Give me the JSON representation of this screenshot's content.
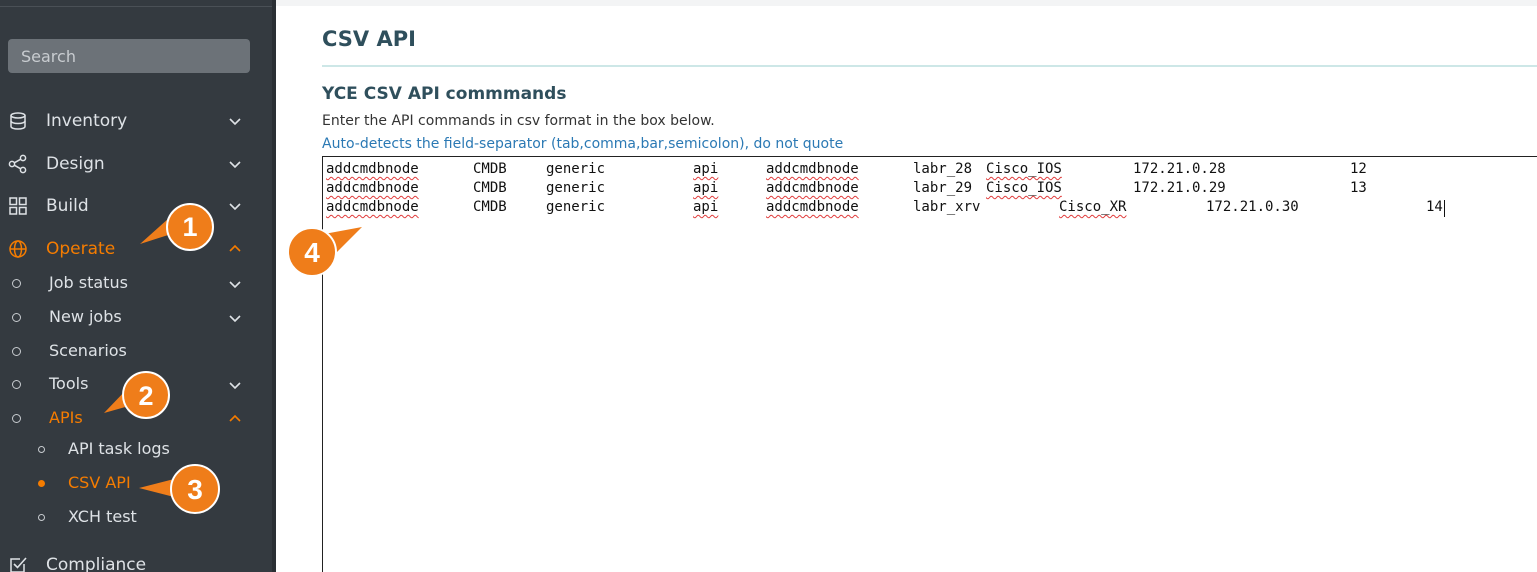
{
  "sidebar": {
    "search_placeholder": "Search",
    "items": [
      {
        "label": "Inventory",
        "icon": "database-icon",
        "expanded": false
      },
      {
        "label": "Design",
        "icon": "share-nodes-icon",
        "expanded": false
      },
      {
        "label": "Build",
        "icon": "grid-icon",
        "expanded": false
      },
      {
        "label": "Operate",
        "icon": "globe-icon",
        "expanded": true,
        "active": true
      },
      {
        "label": "Compliance",
        "icon": "checkbox-icon",
        "expanded": false
      }
    ],
    "operate_children": [
      {
        "label": "Job status",
        "has_children": true
      },
      {
        "label": "New jobs",
        "has_children": true
      },
      {
        "label": "Scenarios",
        "has_children": false
      },
      {
        "label": "Tools",
        "has_children": true
      },
      {
        "label": "APIs",
        "has_children": true,
        "expanded": true,
        "active": true
      }
    ],
    "apis_children": [
      {
        "label": "API task logs",
        "active": false
      },
      {
        "label": "CSV API",
        "active": true
      },
      {
        "label": "XCH test",
        "active": false
      }
    ]
  },
  "callouts": [
    "1",
    "2",
    "3",
    "4"
  ],
  "main": {
    "title": "CSV API",
    "section_title": "YCE CSV API commmands",
    "instruction": "Enter the API commands in csv format in the box below.",
    "hint": "Auto-detects the field-separator (tab,comma,bar,semicolon), do not quote",
    "csv_rows": [
      [
        "addcmdbnode",
        "CMDB",
        "generic",
        "api",
        "addcmdbnode",
        "labr_28",
        "Cisco_IOS",
        "172.21.0.28",
        "12"
      ],
      [
        "addcmdbnode",
        "CMDB",
        "generic",
        "api",
        "addcmdbnode",
        "labr_29",
        "Cisco_IOS",
        "172.21.0.29",
        "13"
      ],
      [
        "addcmdbnode",
        "CMDB",
        "generic",
        "api",
        "addcmdbnode",
        "labr_xrv",
        "Cisco_XR",
        "172.21.0.30",
        "14"
      ]
    ]
  },
  "colors": {
    "sidebar_bg": "#343a40",
    "accent": "#f57c00",
    "callout": "#ef7d1a",
    "title": "#2f4f5c",
    "hint": "#2b79b4"
  }
}
